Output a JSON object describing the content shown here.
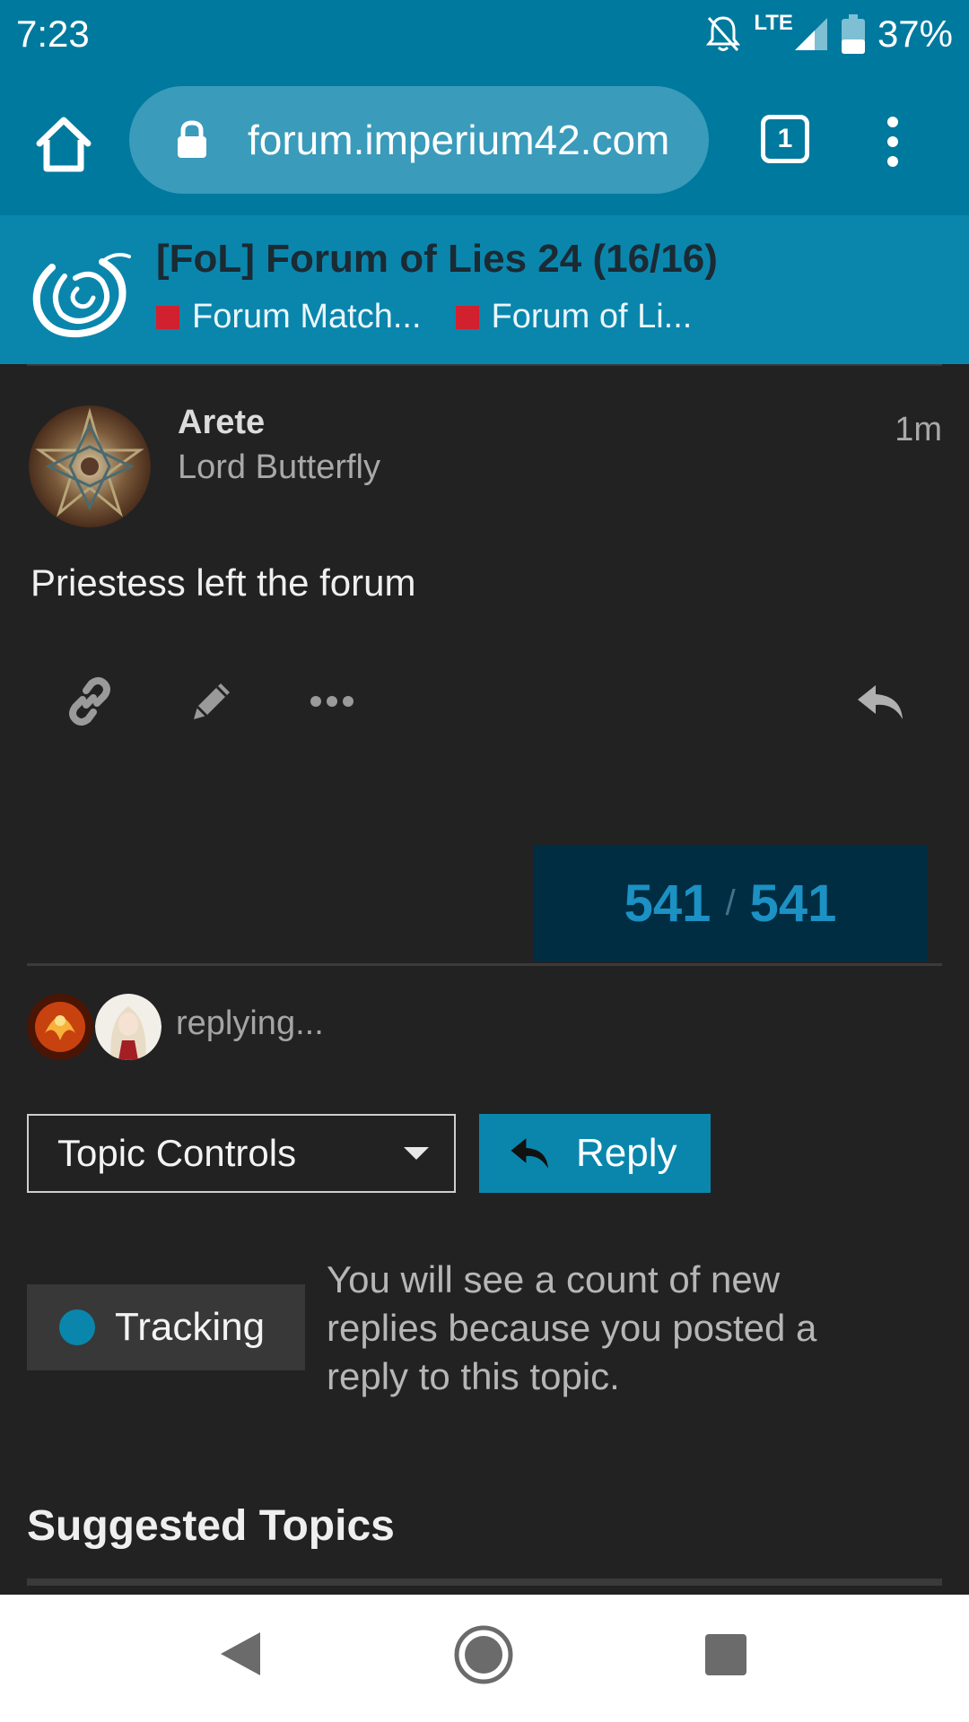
{
  "status_bar": {
    "time": "7:23",
    "network": "LTE",
    "battery": "37%"
  },
  "browser": {
    "url": "forum.imperium42.com",
    "tab_count": "1"
  },
  "topic": {
    "title": "[FoL] Forum of Lies 24 (16/16)",
    "breadcrumbs": [
      "Forum Match...",
      "Forum of Li..."
    ]
  },
  "post": {
    "username": "Arete",
    "user_title": "Lord Butterfly",
    "time": "1m",
    "body": "Priestess left the forum"
  },
  "progress": {
    "current": "541",
    "separator": "/",
    "total": "541"
  },
  "replying": {
    "text": "replying..."
  },
  "controls": {
    "topic_controls_label": "Topic Controls",
    "reply_label": "Reply"
  },
  "tracking": {
    "label": "Tracking",
    "description": "You will see a count of new replies because you posted a reply to this topic."
  },
  "suggested": {
    "heading": "Suggested Topics"
  },
  "colors": {
    "accent": "#0a86ad",
    "status_bar": "#00799e",
    "crumb": "#d1202e",
    "background": "#222222"
  }
}
